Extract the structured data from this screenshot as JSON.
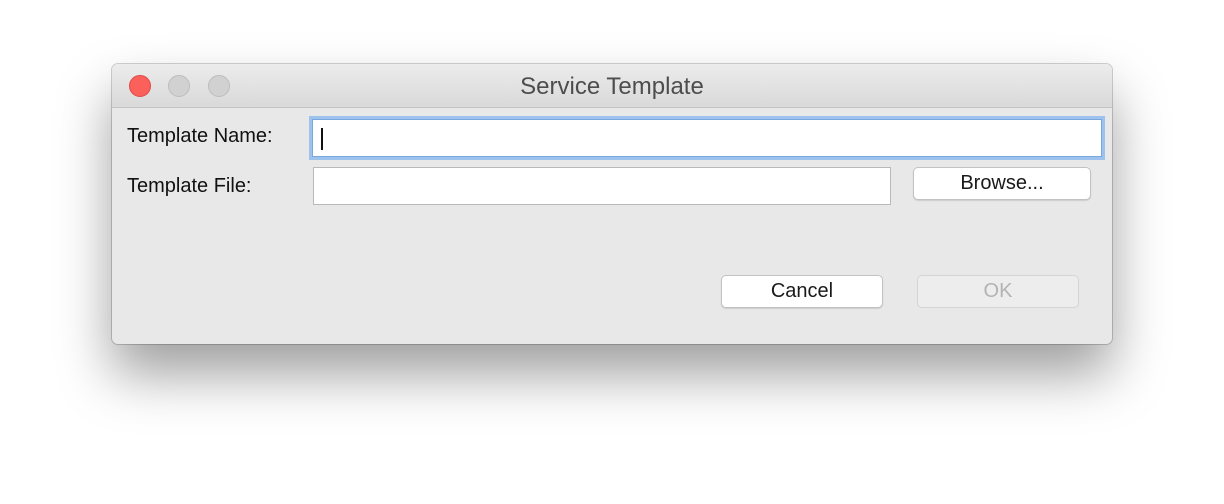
{
  "window": {
    "title": "Service Template"
  },
  "form": {
    "template_name_label": "Template Name:",
    "template_name_value": "",
    "template_file_label": "Template File:",
    "template_file_value": "",
    "browse_label": "Browse..."
  },
  "buttons": {
    "cancel_label": "Cancel",
    "ok_label": "OK",
    "ok_enabled": false
  },
  "colors": {
    "close": "#fc605b",
    "focus_ring": "#9ec2ee",
    "window_bg": "#e8e8e8"
  }
}
